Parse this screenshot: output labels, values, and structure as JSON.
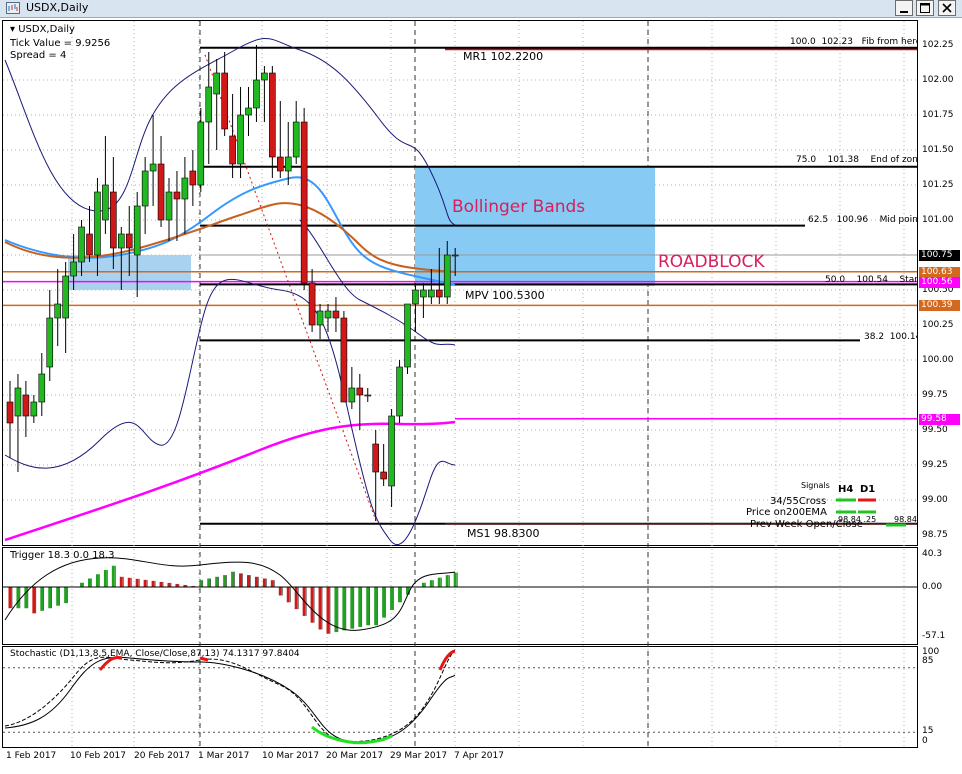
{
  "window": {
    "title": "USDX,Daily"
  },
  "info": {
    "symbol_line": "USDX,Daily",
    "tick_value": "Tick Value = 9.9256",
    "spread": "Spread = 4"
  },
  "annotations": {
    "bollinger": "Bollinger Bands",
    "roadblock": "ROADBLOCK",
    "mr1": "MR1  102.2200",
    "mpv": "MPV  100.5300",
    "ms1": "MS1  98.8300"
  },
  "fib_labels": [
    {
      "left": "100.0",
      "mid": "102.23",
      "right": "Fib from here"
    },
    {
      "left": "75.0",
      "mid": "101.38",
      "right": "End of zone"
    },
    {
      "left": "62.5",
      "mid": "100.96",
      "right": "Mid point"
    },
    {
      "left": "50.0",
      "mid": "100.54",
      "right": "Start"
    },
    {
      "left": "38.2",
      "mid": "100.14",
      "right": ""
    }
  ],
  "signals": {
    "title": "Signals",
    "col_h4": "H4",
    "col_d1": "D1",
    "row1": "34/55Cross",
    "row2": "Price on200EMA",
    "row3": "Prev Week Open/Close",
    "prev_vals": "98.84   .25",
    "prev_right": "98.84",
    "colors": {
      "buy": "#22c322",
      "sell": "#e81515"
    }
  },
  "price_axis": {
    "labels": [
      "102.25",
      "102.00",
      "101.75",
      "101.50",
      "101.25",
      "101.00",
      "100.75",
      "100.50",
      "100.25",
      "100.00",
      "99.75",
      "99.50",
      "99.25",
      "99.00",
      "98.75"
    ],
    "boxes": [
      {
        "text": "100.75",
        "bg": "#000000",
        "fg": "#ffffff"
      },
      {
        "text": "100.63",
        "bg": "#d2691e",
        "fg": "#ffffff"
      },
      {
        "text": "100.56",
        "bg": "#ff00ff",
        "fg": "#ffffff"
      },
      {
        "text": "100.39",
        "bg": "#d2691e",
        "fg": "#ffffff"
      },
      {
        "text": "99.58",
        "bg": "#ff00ff",
        "fg": "#ffffff"
      }
    ]
  },
  "trigger": {
    "label": "Trigger 18.3 0.0 18.3",
    "axis_top": "40.3",
    "axis_mid": "0.00",
    "axis_bottom": "-57.1"
  },
  "stochastic": {
    "label": "Stochastic (D1,13,8,5,EMA, Close/Close,87,13) 74.1317 97.8404",
    "axis": [
      "100",
      "85",
      "15",
      "0"
    ]
  },
  "time_axis": [
    "1 Feb 2017",
    "10 Feb 2017",
    "20 Feb 2017",
    "1 Mar 2017",
    "10 Mar 2017",
    "20 Mar 2017",
    "29 Mar 2017",
    "7 Apr 2017"
  ],
  "chart_data": {
    "type": "candlestick",
    "symbol": "USDX",
    "timeframe": "Daily",
    "ylim": [
      98.6,
      102.35
    ],
    "candles": [
      {
        "o": 99.7,
        "h": 99.85,
        "l": 99.3,
        "c": 99.55
      },
      {
        "o": 99.6,
        "h": 99.9,
        "l": 99.2,
        "c": 99.8
      },
      {
        "o": 99.75,
        "h": 99.85,
        "l": 99.45,
        "c": 99.6
      },
      {
        "o": 99.6,
        "h": 99.75,
        "l": 99.55,
        "c": 99.7
      },
      {
        "o": 99.7,
        "h": 100.05,
        "l": 99.6,
        "c": 99.9
      },
      {
        "o": 99.95,
        "h": 100.5,
        "l": 99.85,
        "c": 100.3
      },
      {
        "o": 100.3,
        "h": 100.65,
        "l": 100.1,
        "c": 100.4
      },
      {
        "o": 100.3,
        "h": 100.7,
        "l": 100.05,
        "c": 100.6
      },
      {
        "o": 100.6,
        "h": 100.9,
        "l": 100.5,
        "c": 100.7
      },
      {
        "o": 100.7,
        "h": 101.0,
        "l": 100.6,
        "c": 100.95
      },
      {
        "o": 100.9,
        "h": 101.1,
        "l": 100.7,
        "c": 100.75
      },
      {
        "o": 100.75,
        "h": 101.3,
        "l": 100.6,
        "c": 101.2
      },
      {
        "o": 101.0,
        "h": 101.6,
        "l": 100.9,
        "c": 101.25
      },
      {
        "o": 101.2,
        "h": 101.45,
        "l": 100.65,
        "c": 100.8
      },
      {
        "o": 100.8,
        "h": 100.95,
        "l": 100.5,
        "c": 100.9
      },
      {
        "o": 100.9,
        "h": 101.1,
        "l": 100.6,
        "c": 100.8
      },
      {
        "o": 100.75,
        "h": 101.2,
        "l": 100.45,
        "c": 101.1
      },
      {
        "o": 101.1,
        "h": 101.45,
        "l": 100.9,
        "c": 101.35
      },
      {
        "o": 101.35,
        "h": 101.75,
        "l": 101.1,
        "c": 101.4
      },
      {
        "o": 101.4,
        "h": 101.6,
        "l": 100.95,
        "c": 101.0
      },
      {
        "o": 101.0,
        "h": 101.3,
        "l": 100.85,
        "c": 101.2
      },
      {
        "o": 101.2,
        "h": 101.35,
        "l": 100.85,
        "c": 101.15
      },
      {
        "o": 101.15,
        "h": 101.45,
        "l": 100.9,
        "c": 101.3
      },
      {
        "o": 101.35,
        "h": 101.5,
        "l": 101.1,
        "c": 101.25
      },
      {
        "o": 101.25,
        "h": 101.8,
        "l": 101.2,
        "c": 101.7
      },
      {
        "o": 101.7,
        "h": 102.2,
        "l": 101.4,
        "c": 101.95
      },
      {
        "o": 101.9,
        "h": 102.15,
        "l": 101.5,
        "c": 102.05
      },
      {
        "o": 102.05,
        "h": 102.2,
        "l": 101.6,
        "c": 101.65
      },
      {
        "o": 101.6,
        "h": 101.9,
        "l": 101.3,
        "c": 101.4
      },
      {
        "o": 101.4,
        "h": 101.95,
        "l": 101.3,
        "c": 101.75
      },
      {
        "o": 101.75,
        "h": 101.95,
        "l": 101.6,
        "c": 101.8
      },
      {
        "o": 101.8,
        "h": 102.25,
        "l": 101.7,
        "c": 102.0
      },
      {
        "o": 102.0,
        "h": 102.1,
        "l": 101.7,
        "c": 102.05
      },
      {
        "o": 102.05,
        "h": 102.1,
        "l": 101.3,
        "c": 101.45
      },
      {
        "o": 101.45,
        "h": 101.85,
        "l": 101.3,
        "c": 101.35
      },
      {
        "o": 101.35,
        "h": 101.7,
        "l": 101.25,
        "c": 101.45
      },
      {
        "o": 101.45,
        "h": 101.85,
        "l": 101.4,
        "c": 101.7
      },
      {
        "o": 101.7,
        "h": 101.8,
        "l": 100.5,
        "c": 100.55
      },
      {
        "o": 100.55,
        "h": 100.65,
        "l": 100.2,
        "c": 100.25
      },
      {
        "o": 100.25,
        "h": 100.4,
        "l": 100.15,
        "c": 100.35
      },
      {
        "o": 100.3,
        "h": 100.4,
        "l": 100.2,
        "c": 100.35
      },
      {
        "o": 100.35,
        "h": 100.45,
        "l": 100.2,
        "c": 100.3
      },
      {
        "o": 100.3,
        "h": 100.35,
        "l": 99.7,
        "c": 99.7
      },
      {
        "o": 99.7,
        "h": 99.95,
        "l": 99.65,
        "c": 99.8
      },
      {
        "o": 99.8,
        "h": 99.9,
        "l": 99.5,
        "c": 99.75
      },
      {
        "o": 99.75,
        "h": 99.8,
        "l": 99.7,
        "c": 99.75
      },
      {
        "o": 99.4,
        "h": 99.5,
        "l": 98.85,
        "c": 99.2
      },
      {
        "o": 99.2,
        "h": 99.4,
        "l": 99.1,
        "c": 99.15
      },
      {
        "o": 99.1,
        "h": 99.65,
        "l": 98.95,
        "c": 99.6
      },
      {
        "o": 99.6,
        "h": 100.0,
        "l": 99.55,
        "c": 99.95
      },
      {
        "o": 99.95,
        "h": 100.4,
        "l": 99.9,
        "c": 100.4
      },
      {
        "o": 100.4,
        "h": 100.55,
        "l": 100.2,
        "c": 100.5
      },
      {
        "o": 100.45,
        "h": 100.55,
        "l": 100.3,
        "c": 100.5
      },
      {
        "o": 100.45,
        "h": 100.65,
        "l": 100.4,
        "c": 100.5
      },
      {
        "o": 100.5,
        "h": 100.8,
        "l": 100.4,
        "c": 100.45
      },
      {
        "o": 100.45,
        "h": 100.85,
        "l": 100.4,
        "c": 100.75
      },
      {
        "o": 100.75,
        "h": 100.8,
        "l": 100.6,
        "c": 100.75
      }
    ],
    "levels": [
      102.23,
      102.22,
      101.38,
      100.96,
      100.54,
      100.53,
      100.14,
      98.83
    ],
    "ema200_value": 99.58,
    "trigger_range": [
      -57.1,
      40.3
    ],
    "stoch_range": [
      0,
      100
    ]
  }
}
